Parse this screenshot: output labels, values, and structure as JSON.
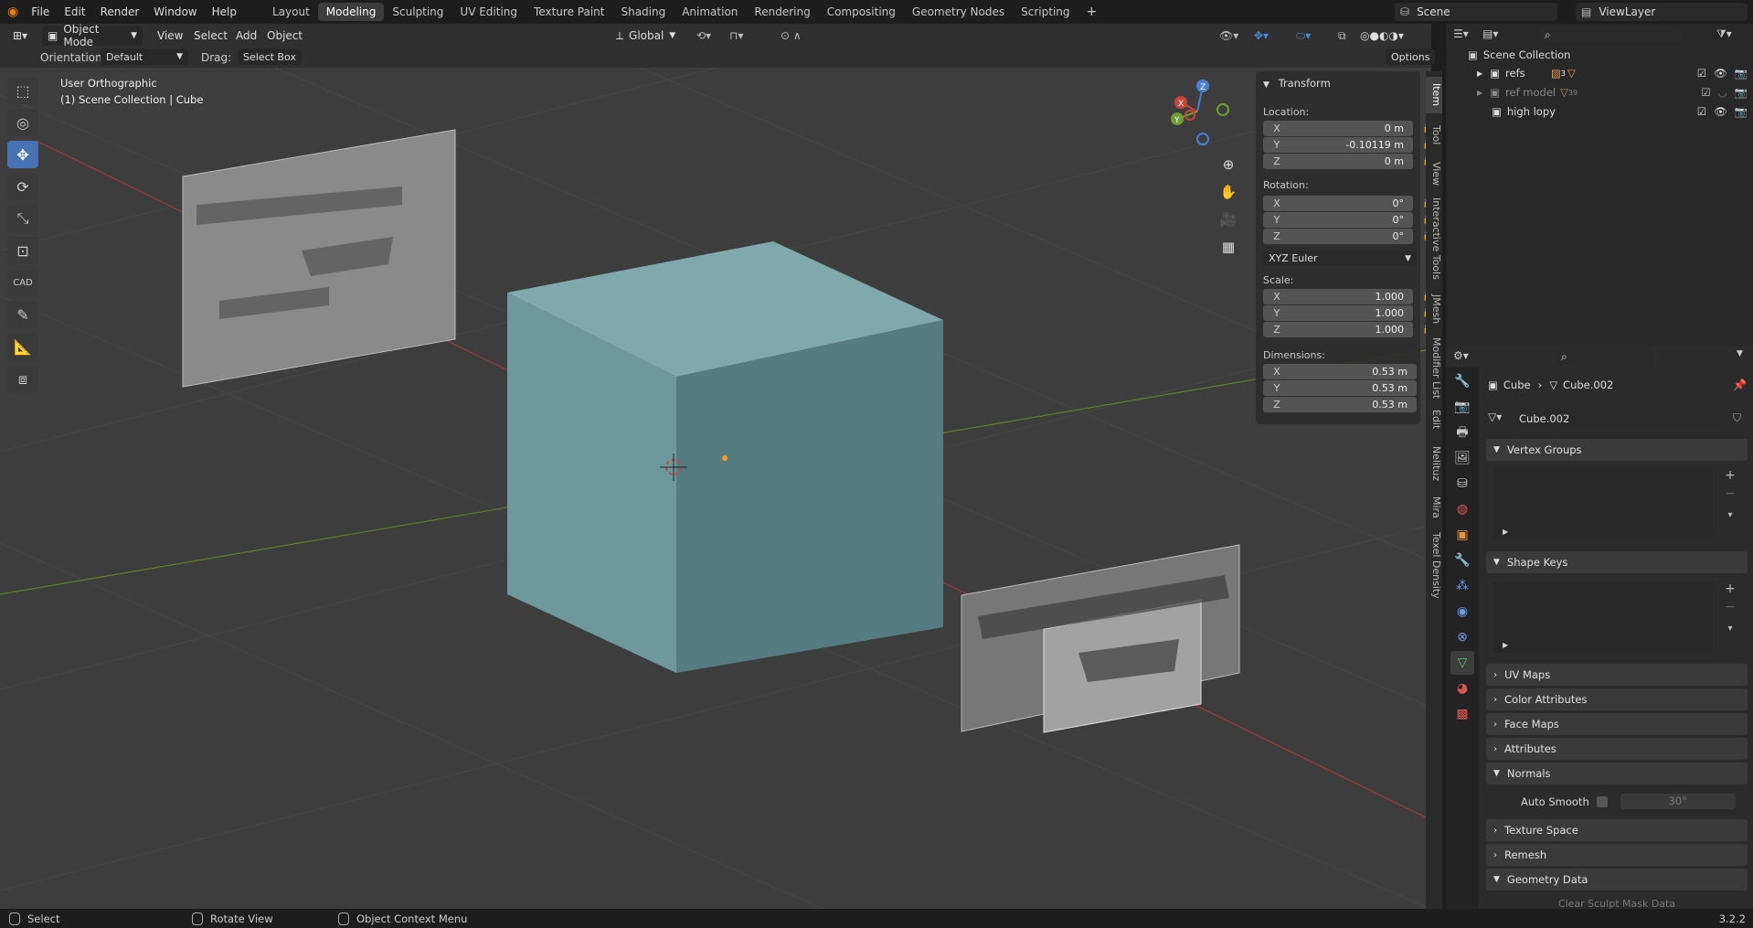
{
  "topbar": {
    "menus": [
      "File",
      "Edit",
      "Render",
      "Window",
      "Help"
    ],
    "workspaces": [
      "Layout",
      "Modeling",
      "Sculpting",
      "UV Editing",
      "Texture Paint",
      "Shading",
      "Animation",
      "Rendering",
      "Compositing",
      "Geometry Nodes",
      "Scripting"
    ],
    "active_workspace": "Modeling",
    "scene": "Scene",
    "view_layer": "ViewLayer"
  },
  "viewport_header": {
    "mode": "Object Mode",
    "menus": [
      "View",
      "Select",
      "Add",
      "Object"
    ],
    "transform_orientation": "Global",
    "orientation_label": "Orientation:",
    "orientation_value": "Default",
    "drag_label": "Drag:",
    "drag_value": "Select Box",
    "options": "Options"
  },
  "viewport": {
    "view_name": "User Orthographic",
    "collection_info": "(1) Scene Collection | Cube",
    "tools": [
      "select-box",
      "cursor",
      "move",
      "rotate",
      "scale",
      "transform",
      "cad",
      "annotate",
      "measure",
      "add-cube"
    ],
    "active_tool": "move",
    "cad_label": "CAD",
    "gizmo_axes": [
      "X",
      "Y",
      "Z"
    ]
  },
  "transform_panel": {
    "title": "Transform",
    "location_label": "Location:",
    "location": [
      {
        "axis": "X",
        "value": "0 m"
      },
      {
        "axis": "Y",
        "value": "-0.10119 m"
      },
      {
        "axis": "Z",
        "value": "0 m"
      }
    ],
    "rotation_label": "Rotation:",
    "rotation": [
      {
        "axis": "X",
        "value": "0°"
      },
      {
        "axis": "Y",
        "value": "0°"
      },
      {
        "axis": "Z",
        "value": "0°"
      }
    ],
    "rotation_mode": "XYZ Euler",
    "scale_label": "Scale:",
    "scale": [
      {
        "axis": "X",
        "value": "1.000"
      },
      {
        "axis": "Y",
        "value": "1.000"
      },
      {
        "axis": "Z",
        "value": "1.000"
      }
    ],
    "dimensions_label": "Dimensions:",
    "dimensions": [
      {
        "axis": "X",
        "value": "0.53 m"
      },
      {
        "axis": "Y",
        "value": "0.53 m"
      },
      {
        "axis": "Z",
        "value": "0.53 m"
      }
    ]
  },
  "sidebar_tabs": [
    "Item",
    "Tool",
    "View",
    "Interactive Tools",
    "JMesh",
    "Modifier List",
    "Edit",
    "Nelituz",
    "Mira",
    "Texel Density"
  ],
  "outliner": {
    "root": "Scene Collection",
    "items": [
      {
        "name": "refs",
        "badge": "3"
      },
      {
        "name": "ref model",
        "badge": "39"
      },
      {
        "name": "high lopy",
        "badge": ""
      }
    ]
  },
  "properties": {
    "breadcrumb_object": "Cube",
    "breadcrumb_data": "Cube.002",
    "datablock": "Cube.002",
    "sections": {
      "vertex_groups": "Vertex Groups",
      "shape_keys": "Shape Keys",
      "uv_maps": "UV Maps",
      "color_attributes": "Color Attributes",
      "face_maps": "Face Maps",
      "attributes": "Attributes",
      "normals": "Normals",
      "auto_smooth": "Auto Smooth",
      "auto_smooth_angle": "30°",
      "texture_space": "Texture Space",
      "remesh": "Remesh",
      "geometry_data": "Geometry Data",
      "clear_sculpt": "Clear Sculpt Mask Data"
    }
  },
  "statusbar": {
    "select": "Select",
    "rotate_view": "Rotate View",
    "context_menu": "Object Context Menu",
    "version": "3.2.2"
  },
  "colors": {
    "accent": "#4772b3",
    "cube_front": "#6e999c",
    "cube_right": "#557c80",
    "cube_top": "#7fa9ac",
    "x_axis": "#a33a3a",
    "y_axis": "#6b8e2f"
  }
}
